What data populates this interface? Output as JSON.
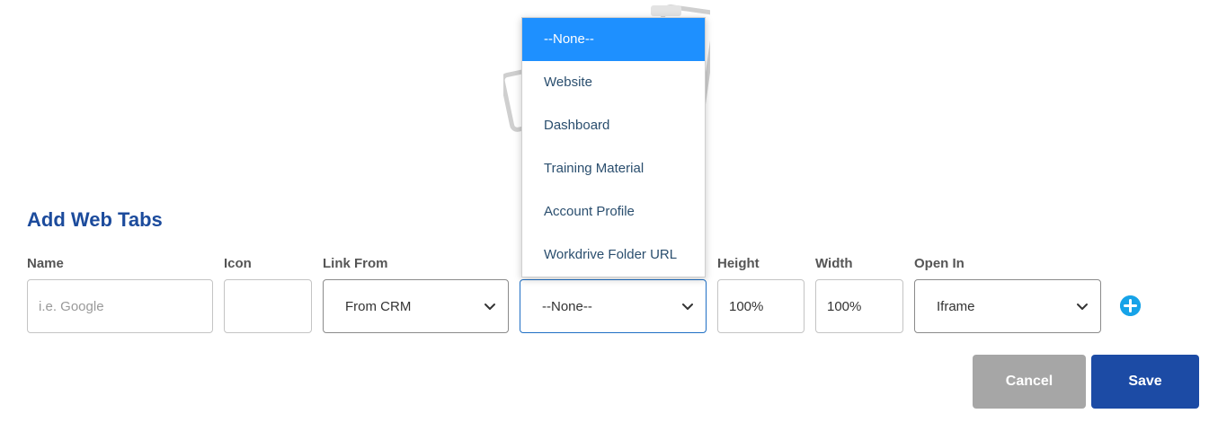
{
  "section_title": "Add Web Tabs",
  "columns": {
    "name": "Name",
    "icon": "Icon",
    "link_from": "Link From",
    "height": "Height",
    "width": "Width",
    "open_in": "Open In"
  },
  "row": {
    "name_placeholder": "i.e. Google",
    "icon_value": "",
    "link_from_value": "From CRM",
    "link_value": "--None--",
    "height_value": "100%",
    "width_value": "100%",
    "open_in_value": "Iframe"
  },
  "dropdown": {
    "selected_index": 0,
    "options": [
      "--None--",
      "Website",
      "Dashboard",
      "Training Material",
      "Account Profile",
      "Workdrive Folder URL"
    ]
  },
  "buttons": {
    "cancel": "Cancel",
    "save": "Save"
  },
  "icons": {
    "add": "plus-circle-icon",
    "chevron": "chevron-down-icon"
  },
  "colors": {
    "title": "#1c4b9c",
    "selected_option": "#1e90ff",
    "save": "#1c4ba5",
    "cancel": "#a6a6a6",
    "add_icon": "#17a3e8"
  }
}
